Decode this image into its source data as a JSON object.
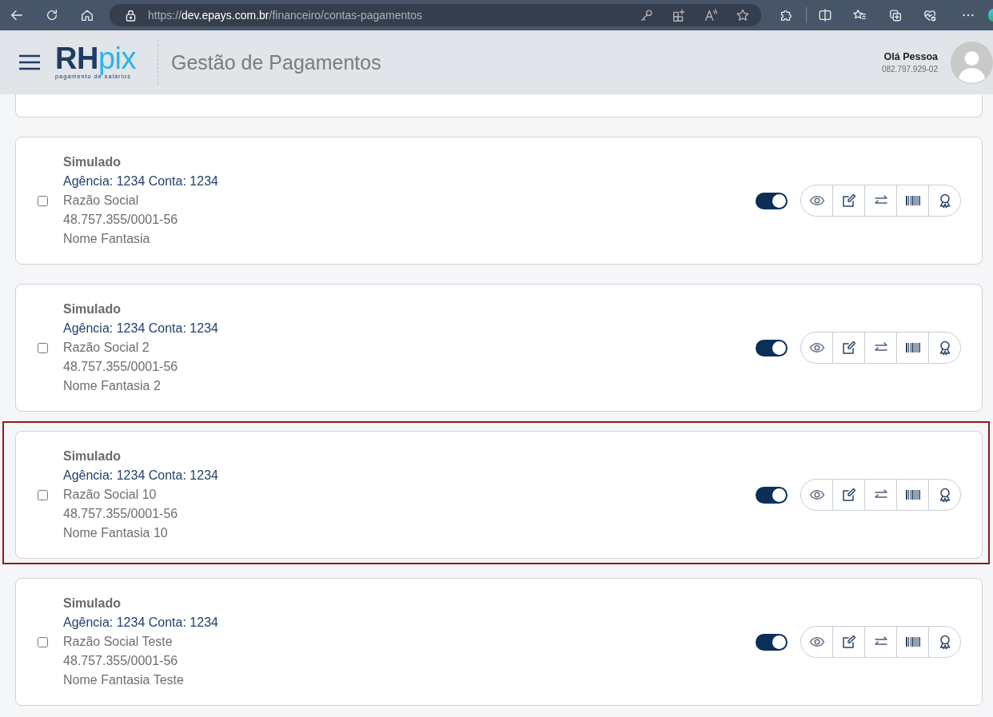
{
  "browser": {
    "url": {
      "scheme": "https://",
      "host": "dev.epays.com.br",
      "path": "/financeiro/contas-pagamentos"
    }
  },
  "header": {
    "logo": {
      "primary": "RH",
      "accent": "pix",
      "tagline": "pagamento de salários"
    },
    "title": "Gestão de Pagamentos",
    "user": {
      "greeting": "Olá Pessoa",
      "document": "082.797.929-02"
    }
  },
  "clipped_card_above": true,
  "accounts": [
    {
      "bank": "Simulado",
      "agency_account": "Agência: 1234 Conta: 1234",
      "company_name": "Razão Social",
      "cnpj": "48.757.355/0001-56",
      "trade_name": "Nome Fantasia",
      "checked": false,
      "active": true,
      "highlighted": false
    },
    {
      "bank": "Simulado",
      "agency_account": "Agência: 1234 Conta: 1234",
      "company_name": "Razão Social 2",
      "cnpj": "48.757.355/0001-56",
      "trade_name": "Nome Fantasia 2",
      "checked": false,
      "active": true,
      "highlighted": false
    },
    {
      "bank": "Simulado",
      "agency_account": "Agência: 1234 Conta: 1234",
      "company_name": "Razão Social 10",
      "cnpj": "48.757.355/0001-56",
      "trade_name": "Nome Fantasia 10",
      "checked": false,
      "active": true,
      "highlighted": true
    },
    {
      "bank": "Simulado",
      "agency_account": "Agência: 1234 Conta: 1234",
      "company_name": "Razão Social Teste",
      "cnpj": "48.757.355/0001-56",
      "trade_name": "Nome Fantasia Teste",
      "checked": false,
      "active": true,
      "highlighted": false
    }
  ]
}
